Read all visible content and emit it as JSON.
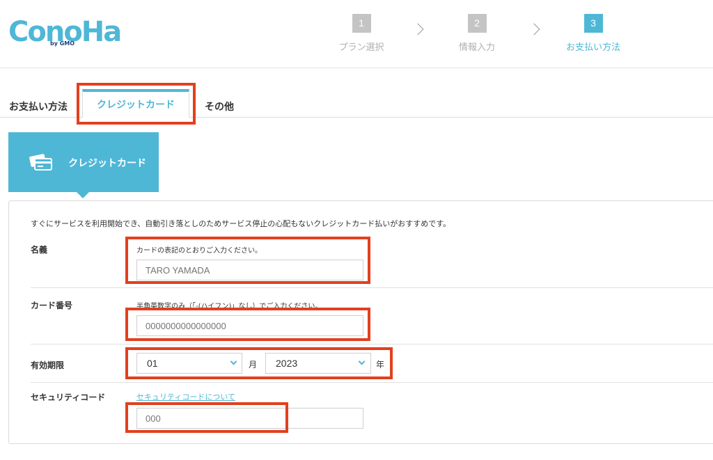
{
  "brand": {
    "logo_text": "ConoHa",
    "logo_sub": "by GMO",
    "color": "#4fb7d6",
    "highlight_color": "#e2401e"
  },
  "steps": [
    {
      "num": "1",
      "label": "プラン選択",
      "active": false
    },
    {
      "num": "2",
      "label": "情報入力",
      "active": false
    },
    {
      "num": "3",
      "label": "お支払い方法",
      "active": true
    }
  ],
  "tabs": {
    "section_label": "お支払い方法",
    "items": [
      {
        "label": "クレジットカード",
        "active": true
      },
      {
        "label": "その他",
        "active": false
      }
    ]
  },
  "card_tile": {
    "label": "クレジットカード",
    "icon": "credit-card-icon"
  },
  "form": {
    "intro": "すぐにサービスを利用開始でき、自動引き落としのためサービス停止の心配もないクレジットカード払いがおすすめです。",
    "name": {
      "label": "名義",
      "hint": "カードの表記のとおりご入力ください。",
      "placeholder": "TARO YAMADA"
    },
    "card_number": {
      "label": "カード番号",
      "hint": "半角英数字のみ（「-(ハイフン)」なし）でご入力ください。",
      "placeholder": "0000000000000000"
    },
    "expiry": {
      "label": "有効期限",
      "month_value": "01",
      "month_unit": "月",
      "year_value": "2023",
      "year_unit": "年"
    },
    "security_code": {
      "label": "セキュリティコード",
      "link": "セキュリティコードについて",
      "placeholder": "000"
    }
  }
}
